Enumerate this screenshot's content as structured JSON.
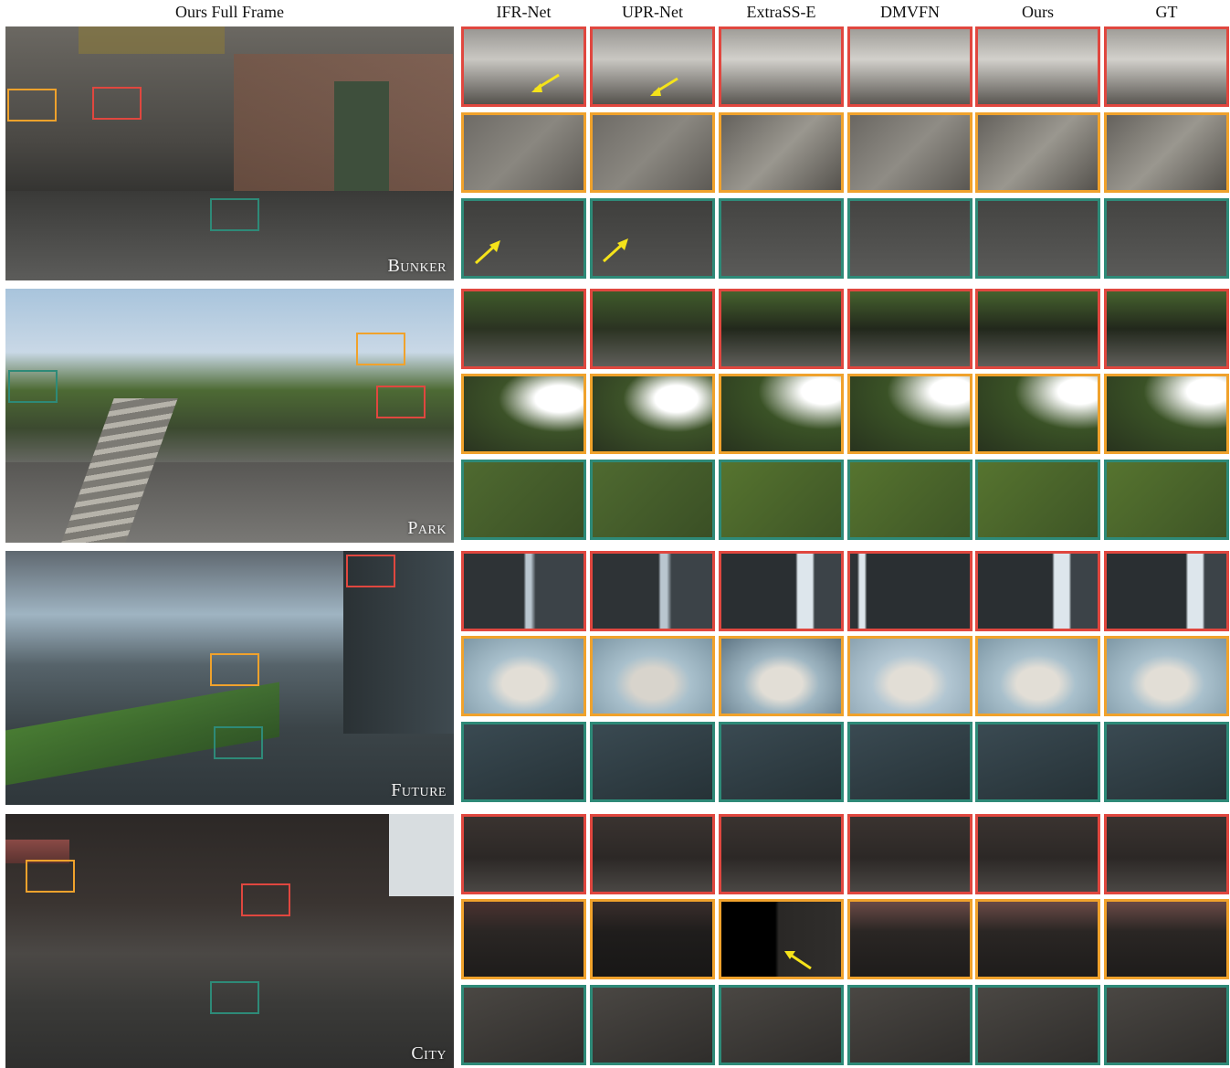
{
  "headers": {
    "full_frame": "Ours Full Frame",
    "methods": [
      "IFR-Net",
      "UPR-Net",
      "ExtraSS-E",
      "DMVFN",
      "Ours",
      "GT"
    ]
  },
  "scenes": [
    {
      "label": "Bunker",
      "bg": "#4a4844"
    },
    {
      "label": "Park",
      "bg": "#5d6c4a"
    },
    {
      "label": "Future",
      "bg": "#4e5b63"
    },
    {
      "label": "City",
      "bg": "#2f2e2c"
    }
  ],
  "box_colors": {
    "red": "#e0473f",
    "orange": "#f0a22c",
    "teal": "#2e8a78"
  },
  "arrow_color": "#f5e31a"
}
